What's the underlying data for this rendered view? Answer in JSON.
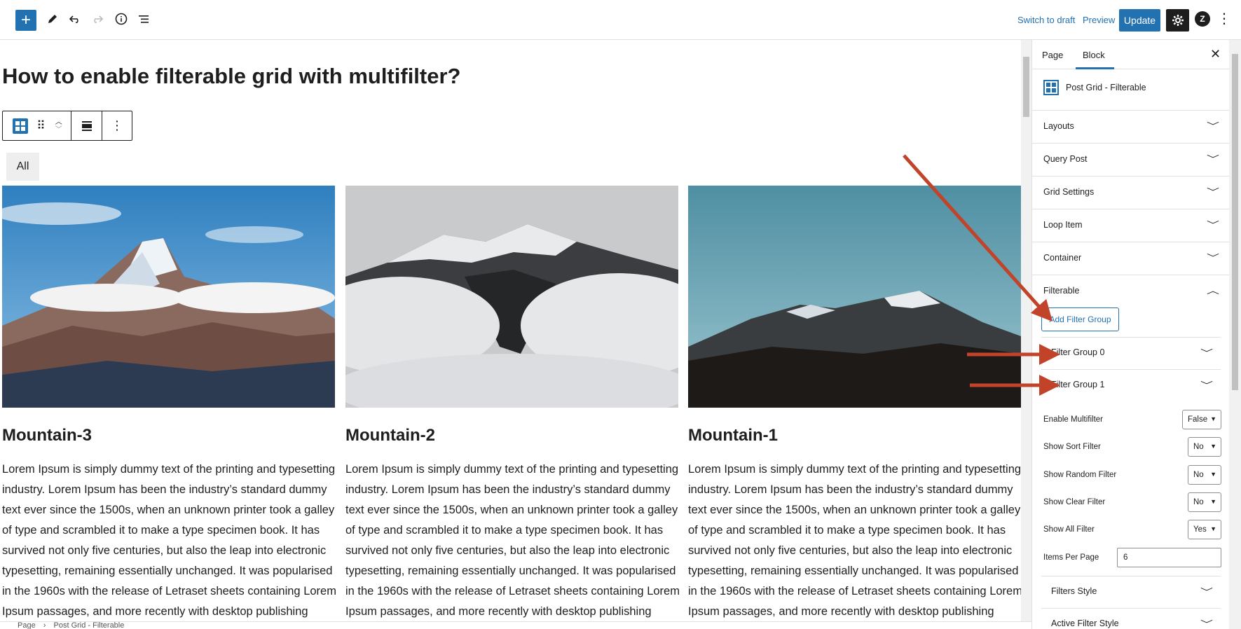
{
  "toolbar": {
    "switch_to_draft": "Switch to draft",
    "preview": "Preview",
    "update": "Update",
    "icons": [
      "plus-icon",
      "pencil-icon",
      "undo-icon",
      "redo-icon",
      "info-icon",
      "list-view-icon",
      "gear-icon",
      "plugin-icon",
      "more-vertical-icon"
    ]
  },
  "post": {
    "title": "How to enable filterable grid with multifilter?",
    "filter_all": "All",
    "cards": [
      {
        "title": "Mountain-3",
        "text": "Lorem Ipsum is simply dummy text of the printing and typesetting industry. Lorem Ipsum has been the industry’s standard dummy text ever since the 1500s, when an unknown printer took a galley of type and scrambled it to make a type specimen book. It has survived not only five centuries, but also the leap into electronic typesetting, remaining essentially unchanged. It was popularised in the 1960s with the release of Letraset sheets containing Lorem Ipsum passages, and more recently with desktop publishing"
      },
      {
        "title": "Mountain-2",
        "text": "Lorem Ipsum is simply dummy text of the printing and typesetting industry. Lorem Ipsum has been the industry’s standard dummy text ever since the 1500s, when an unknown printer took a galley of type and scrambled it to make a type specimen book. It has survived not only five centuries, but also the leap into electronic typesetting, remaining essentially unchanged. It was popularised in the 1960s with the release of Letraset sheets containing Lorem Ipsum passages, and more recently with desktop publishing"
      },
      {
        "title": "Mountain-1",
        "text": "Lorem Ipsum is simply dummy text of the printing and typesetting industry. Lorem Ipsum has been the industry’s standard dummy text ever since the 1500s, when an unknown printer took a galley of type and scrambled it to make a type specimen book. It has survived not only five centuries, but also the leap into electronic typesetting, remaining essentially unchanged. It was popularised in the 1960s with the release of Letraset sheets containing Lorem Ipsum passages, and more recently with desktop publishing"
      }
    ]
  },
  "breadcrumb": {
    "items": [
      "Page",
      "Post Grid - Filterable"
    ],
    "separator": "›"
  },
  "sidebar": {
    "tabs": {
      "page": "Page",
      "block": "Block"
    },
    "block_name": "Post Grid - Filterable",
    "panels": {
      "layouts": "Layouts",
      "query_post": "Query Post",
      "grid_settings": "Grid Settings",
      "loop_item": "Loop Item",
      "container": "Container",
      "filterable": "Filterable"
    },
    "add_filter_group": "Add Filter Group",
    "filter_groups": [
      "Filter Group 0",
      "Filter Group 1"
    ],
    "fields": {
      "enable_multifilter": {
        "label": "Enable Multifilter",
        "value": "False"
      },
      "show_sort_filter": {
        "label": "Show Sort Filter",
        "value": "No"
      },
      "show_random_filter": {
        "label": "Show Random Filter",
        "value": "No"
      },
      "show_clear_filter": {
        "label": "Show Clear Filter",
        "value": "No"
      },
      "show_all_filter": {
        "label": "Show All Filter",
        "value": "Yes"
      },
      "items_per_page": {
        "label": "Items Per Page",
        "value": "6"
      }
    },
    "sub_panels": {
      "filters_style": "Filters Style",
      "active_filter_style": "Active Filter Style"
    }
  },
  "colors": {
    "accent": "#2271b1",
    "annotation_arrow": "#c0432a"
  }
}
